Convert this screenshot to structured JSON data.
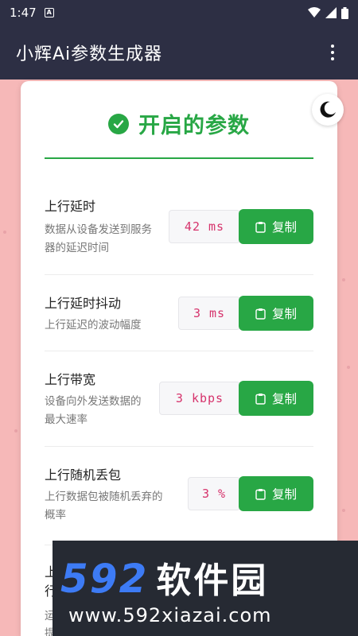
{
  "status_bar": {
    "time": "1:47",
    "badge": "A"
  },
  "app_bar": {
    "title": "小辉Ai参数生成器"
  },
  "card": {
    "title": "开启的参数",
    "params": [
      {
        "name": "上行延时",
        "desc": [
          "数据从设备发送到服务",
          "器的延迟时间"
        ],
        "value": "42 ms",
        "copy_label": "复制"
      },
      {
        "name": "上行延时抖动",
        "desc": [
          "上行延迟的波动幅度"
        ],
        "value": "3 ms",
        "copy_label": "复制"
      },
      {
        "name": "上行带宽",
        "desc": [
          "设备向外发送数据的",
          "最大速率"
        ],
        "value": "3 kbps",
        "copy_label": "复制"
      },
      {
        "name": "上行随机丢包",
        "desc": [
          "上行数据包被随机丢弃的",
          "概率"
        ],
        "value": "3 %",
        "copy_label": "复制"
      },
      {
        "name": "上",
        "desc": [
          "行",
          "运",
          "提"
        ]
      }
    ]
  },
  "watermark": {
    "brand_num": "592",
    "brand_cn": "软件园",
    "url": "www.592xiazai.com"
  },
  "colors": {
    "accent": "#28a745",
    "value_text": "#d6336c",
    "app_bar": "#2d2f44",
    "background": "#f6b8b8"
  },
  "icons": {
    "theme_toggle": "moon-icon",
    "check": "check-circle-icon",
    "copy": "clipboard-icon"
  }
}
